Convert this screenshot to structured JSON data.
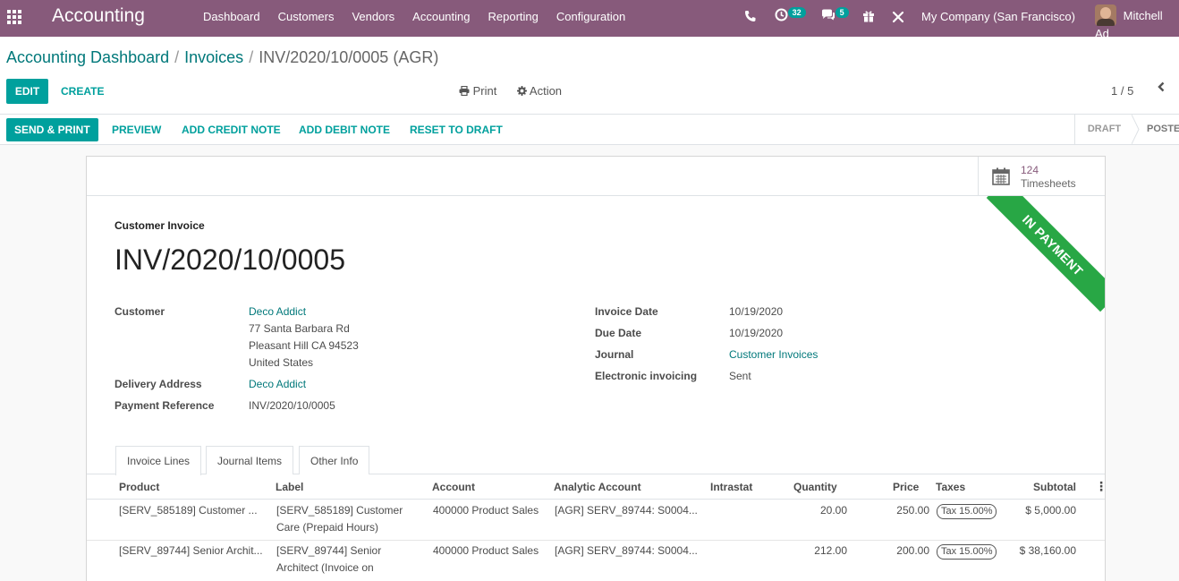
{
  "navbar": {
    "brand": "Accounting",
    "menu": [
      "Dashboard",
      "Customers",
      "Vendors",
      "Accounting",
      "Reporting",
      "Configuration"
    ],
    "activity_count": "32",
    "message_count": "5",
    "company": "My Company (San Francisco)",
    "user": "Mitchell Ad"
  },
  "breadcrumb": {
    "dashboard": "Accounting Dashboard",
    "invoices": "Invoices",
    "current": "INV/2020/10/0005 (AGR)",
    "sep": "/"
  },
  "controls": {
    "edit": "EDIT",
    "create": "CREATE",
    "print": "Print",
    "action": "Action",
    "pager": "1 / 5"
  },
  "header_buttons": {
    "send_print": "SEND & PRINT",
    "preview": "PREVIEW",
    "add_credit_note": "ADD CREDIT NOTE",
    "add_debit_note": "ADD DEBIT NOTE",
    "reset_to_draft": "RESET TO DRAFT"
  },
  "statusbar": {
    "draft": "DRAFT",
    "posted": "POSTED"
  },
  "smart_button": {
    "count": "124",
    "label": "Timesheets"
  },
  "ribbon": "IN PAYMENT",
  "doc": {
    "type": "Customer Invoice",
    "name": "INV/2020/10/0005"
  },
  "fields": {
    "customer_label": "Customer",
    "customer_name": "Deco Addict",
    "address_line1": "77 Santa Barbara Rd",
    "address_line2": "Pleasant Hill CA 94523",
    "address_line3": "United States",
    "delivery_label": "Delivery Address",
    "delivery_value": "Deco Addict",
    "payref_label": "Payment Reference",
    "payref_value": "INV/2020/10/0005",
    "invoice_date_label": "Invoice Date",
    "invoice_date_value": "10/19/2020",
    "due_date_label": "Due Date",
    "due_date_value": "10/19/2020",
    "journal_label": "Journal",
    "journal_value": "Customer Invoices",
    "einv_label": "Electronic invoicing",
    "einv_value": "Sent"
  },
  "tabs": [
    "Invoice Lines",
    "Journal Items",
    "Other Info"
  ],
  "columns": {
    "product": "Product",
    "label": "Label",
    "account": "Account",
    "analytic": "Analytic Account",
    "intrastat": "Intrastat",
    "quantity": "Quantity",
    "price": "Price",
    "taxes": "Taxes",
    "subtotal": "Subtotal"
  },
  "lines": [
    {
      "product": "[SERV_585189] Customer ...",
      "label1": "[SERV_585189] Customer",
      "label2": "Care (Prepaid Hours)",
      "account": "400000 Product Sales",
      "analytic": "[AGR] SERV_89744: S0004...",
      "quantity": "20.00",
      "price": "250.00",
      "tax": "Tax 15.00%",
      "subtotal": "$ 5,000.00"
    },
    {
      "product": "[SERV_89744] Senior Archit...",
      "label1": "[SERV_89744] Senior",
      "label2": "Architect (Invoice on",
      "account": "400000 Product Sales",
      "analytic": "[AGR] SERV_89744: S0004...",
      "quantity": "212.00",
      "price": "200.00",
      "tax": "Tax 15.00%",
      "subtotal": "$ 38,160.00"
    }
  ],
  "colors": {
    "brand": "#875a7b",
    "accent": "#00a09d",
    "link": "#00787a",
    "ribbon": "#28a745"
  }
}
